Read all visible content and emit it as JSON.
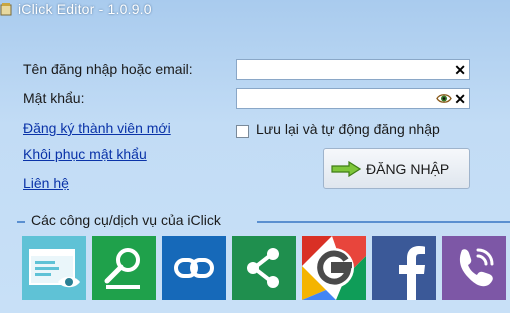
{
  "window": {
    "title": "iClick Editor - 1.0.9.0"
  },
  "login_form": {
    "username_label": "Tên đăng nhập hoặc email:",
    "username_value": "",
    "password_label": "Mật khẩu:",
    "password_value": ""
  },
  "links": {
    "register": "Đăng ký thành viên mới",
    "recover": "Khôi phục mật khẩu",
    "contact": "Liên hệ"
  },
  "remember": {
    "label": "Lưu lại và tự động đăng nhập",
    "checked": false
  },
  "login_button": {
    "label": "ĐĂNG NHẬP"
  },
  "tools": {
    "title": "Các công cụ/dịch vụ của iClick",
    "items": [
      {
        "icon": "browser-view-icon",
        "color": "#5fc2d6"
      },
      {
        "icon": "search-tool-icon",
        "color": "#1fa14b"
      },
      {
        "icon": "link-icon",
        "color": "#1669b9"
      },
      {
        "icon": "share-icon",
        "color": "#1f8f4e"
      },
      {
        "icon": "google-icon",
        "color": "#ffffff"
      },
      {
        "icon": "facebook-icon",
        "color": "#3b5998"
      },
      {
        "icon": "viber-icon",
        "color": "#7d57a6"
      }
    ]
  },
  "colors": {
    "accent": "#5a8fd0",
    "link": "#0a33a8"
  }
}
